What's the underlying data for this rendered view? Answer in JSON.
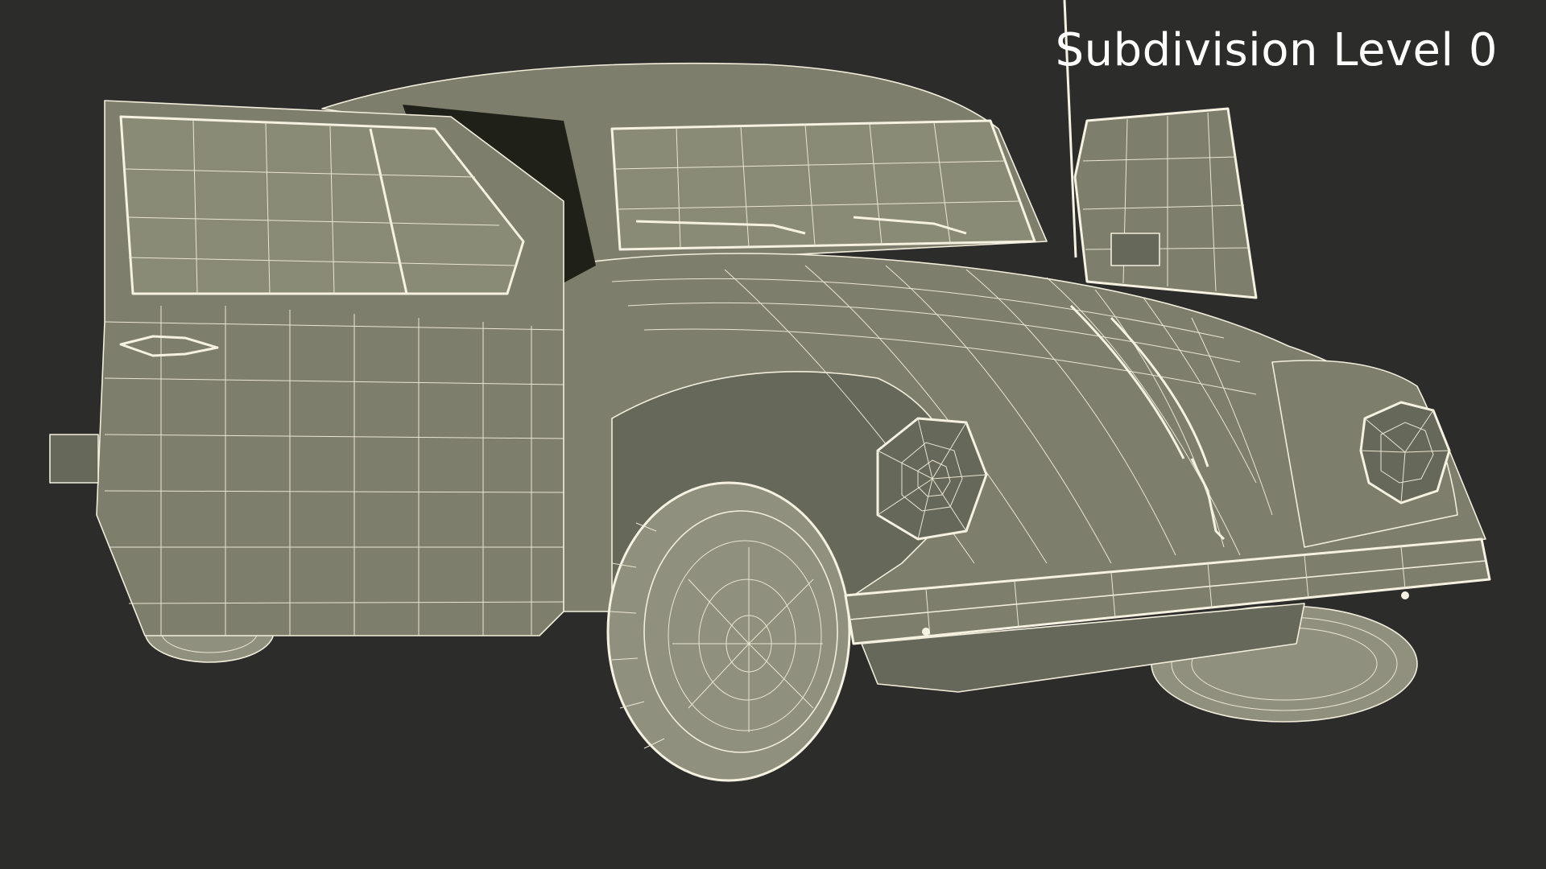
{
  "overlay": {
    "label": "Subdivision Level 0"
  },
  "subject": {
    "icon": "wireframe-car-render"
  },
  "colors": {
    "background": "#2c2c2a",
    "model_fill": "#7d7e6c",
    "wire": "#f1eedc",
    "label": "#ffffff"
  }
}
